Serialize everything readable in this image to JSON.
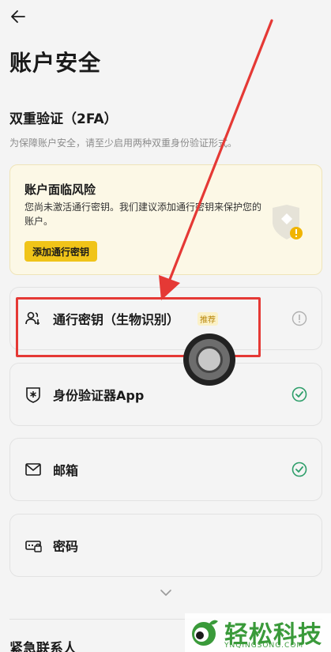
{
  "header": {
    "title": "账户安全"
  },
  "twofa": {
    "title": "双重验证（2FA）",
    "description": "为保障账户安全，请至少启用两种双重身份验证形式。"
  },
  "risk_card": {
    "title": "账户面临风险",
    "body": "您尚未激活通行密钥。我们建议添加通行密钥来保护您的账户。",
    "button_label": "添加通行密钥"
  },
  "methods": [
    {
      "label": "通行密钥（生物识别）",
      "badge": "推荐",
      "icon": "passkey-users-icon",
      "status": "info"
    },
    {
      "label": "身份验证器App",
      "icon": "authenticator-shield-icon",
      "status": "enabled"
    },
    {
      "label": "邮箱",
      "icon": "mail-icon",
      "status": "enabled"
    },
    {
      "label": "密码",
      "icon": "password-icon",
      "status": ""
    }
  ],
  "emergency": {
    "title": "紧急联系人"
  },
  "watermark": {
    "text": "轻松科技",
    "sub": "YNQINGSONG.COM"
  },
  "colors": {
    "accent_yellow": "#f0c419",
    "success_green": "#2e9e6a",
    "annotation_red": "#e53935"
  }
}
